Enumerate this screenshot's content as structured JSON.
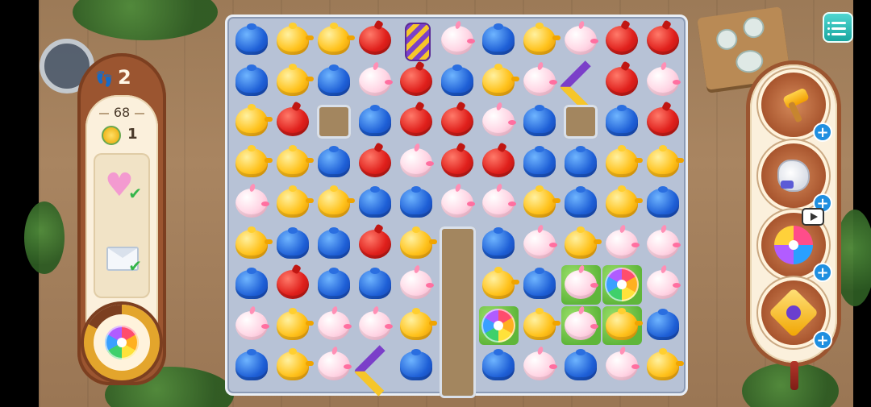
{
  "hud": {
    "moves_remaining": "2",
    "score": "68",
    "medal_count": "1",
    "goals": [
      {
        "name": "heart-goal",
        "completed": true
      },
      {
        "name": "envelope-goal",
        "completed": true
      }
    ],
    "power_booster": {
      "icon": "rainbow-flower-icon",
      "charge_fraction": 0.83
    }
  },
  "tools": [
    {
      "name": "hammer-tool",
      "icon": "hammer-icon",
      "add_label": "+"
    },
    {
      "name": "glove-tool",
      "icon": "glove-icon",
      "add_label": "+"
    },
    {
      "name": "pinwheel-tool",
      "icon": "pinwheel-icon",
      "add_label": "+",
      "video_offer": true
    },
    {
      "name": "star-tool",
      "icon": "star-icon",
      "add_label": "+"
    }
  ],
  "menu": {
    "icon": "list-menu-icon"
  },
  "board": {
    "columns": 11,
    "rows": 9,
    "legend": {
      "B": "blue-jelly",
      "R": "red-apple",
      "Y": "yellow-teapot",
      "P": "pink-bunny",
      "K": "rocket-booster",
      "M": "boomerang-booster",
      "F": "rainbow-flower",
      "_": "empty-tile",
      "X": "blocked"
    },
    "grid": [
      [
        "B",
        "Y",
        "Y",
        "R",
        "K",
        "P",
        "B",
        "Y",
        "P",
        "R",
        "R"
      ],
      [
        "B",
        "Y",
        "B",
        "P",
        "R",
        "B",
        "Y",
        "P",
        "M",
        "R",
        "P"
      ],
      [
        "Y",
        "R",
        "_",
        "B",
        "R",
        "R",
        "P",
        "B",
        "_",
        "B",
        "R"
      ],
      [
        "Y",
        "Y",
        "B",
        "R",
        "P",
        "R",
        "R",
        "B",
        "B",
        "Y",
        "Y"
      ],
      [
        "P",
        "Y",
        "Y",
        "B",
        "B",
        "P",
        "P",
        "Y",
        "B",
        "Y",
        "B"
      ],
      [
        "Y",
        "B",
        "B",
        "R",
        "Y",
        "X",
        "B",
        "P",
        "Y",
        "P",
        "P"
      ],
      [
        "B",
        "R",
        "B",
        "B",
        "P",
        "X",
        "Y",
        "B",
        "P",
        "F",
        "P"
      ],
      [
        "P",
        "Y",
        "P",
        "P",
        "Y",
        "X",
        "F",
        "Y",
        "P",
        "Y",
        "B"
      ],
      [
        "B",
        "Y",
        "P",
        "M",
        "B",
        "X",
        "B",
        "P",
        "B",
        "P",
        "Y"
      ]
    ],
    "grass_cells": [
      [
        6,
        8
      ],
      [
        6,
        9
      ],
      [
        7,
        6
      ],
      [
        7,
        8
      ],
      [
        7,
        9
      ]
    ]
  }
}
